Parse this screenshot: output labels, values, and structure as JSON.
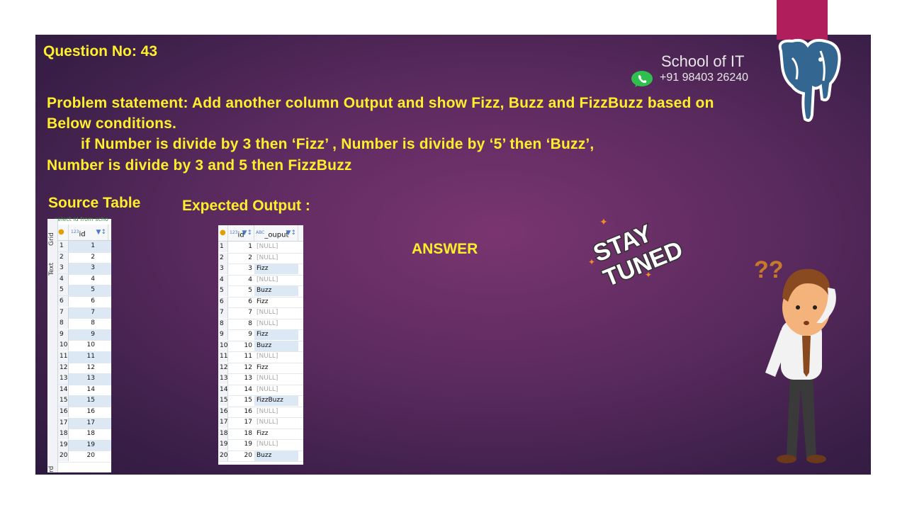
{
  "question_no": "Question No: 43",
  "brand": {
    "name": "School of IT",
    "phone": "+91 98403 26240"
  },
  "problem": {
    "line1": "Problem statement: Add another column Output and show Fizz, Buzz and FizzBuzz based on",
    "line2": "Below conditions.",
    "line3": "if Number is divide by 3 then ‘Fizz’ , Number is divide by ‘5’ then ‘Buzz’,",
    "line4": "Number is divide by 3 and 5 then FizzBuzz"
  },
  "source_title": "Source Table",
  "expected_title": "Expected  Output :",
  "answer_label": "ANSWER",
  "sticker_text": {
    "line1": "STAY",
    "line2": "TUNED"
  },
  "source_table": {
    "sql_hint": "select id from scho",
    "side_tabs": [
      "Grid",
      "Text",
      "rd"
    ],
    "col_type": "123",
    "col": "id",
    "ids": [
      "1",
      "2",
      "3",
      "4",
      "5",
      "6",
      "7",
      "8",
      "9",
      "10",
      "11",
      "12",
      "13",
      "14",
      "15",
      "16",
      "17",
      "18",
      "19",
      "20"
    ]
  },
  "output_table": {
    "col_id_type": "123",
    "col_id": "id",
    "col_out_type": "ABC",
    "col_out": "_ouput",
    "rows": [
      {
        "id": "1",
        "out": "[NULL]"
      },
      {
        "id": "2",
        "out": "[NULL]"
      },
      {
        "id": "3",
        "out": "Fizz"
      },
      {
        "id": "4",
        "out": "[NULL]"
      },
      {
        "id": "5",
        "out": "Buzz"
      },
      {
        "id": "6",
        "out": "Fizz"
      },
      {
        "id": "7",
        "out": "[NULL]"
      },
      {
        "id": "8",
        "out": "[NULL]"
      },
      {
        "id": "9",
        "out": "Fizz"
      },
      {
        "id": "10",
        "out": "Buzz"
      },
      {
        "id": "11",
        "out": "[NULL]"
      },
      {
        "id": "12",
        "out": "Fizz"
      },
      {
        "id": "13",
        "out": "[NULL]"
      },
      {
        "id": "14",
        "out": "[NULL]"
      },
      {
        "id": "15",
        "out": "FizzBuzz"
      },
      {
        "id": "16",
        "out": "[NULL]"
      },
      {
        "id": "17",
        "out": "[NULL]"
      },
      {
        "id": "18",
        "out": "Fizz"
      },
      {
        "id": "19",
        "out": "[NULL]"
      },
      {
        "id": "20",
        "out": "Buzz"
      }
    ]
  },
  "colors": {
    "accent": "#b01e5b",
    "text_yellow": "#ffef2a",
    "bg_purple": "#5a2a5e"
  }
}
